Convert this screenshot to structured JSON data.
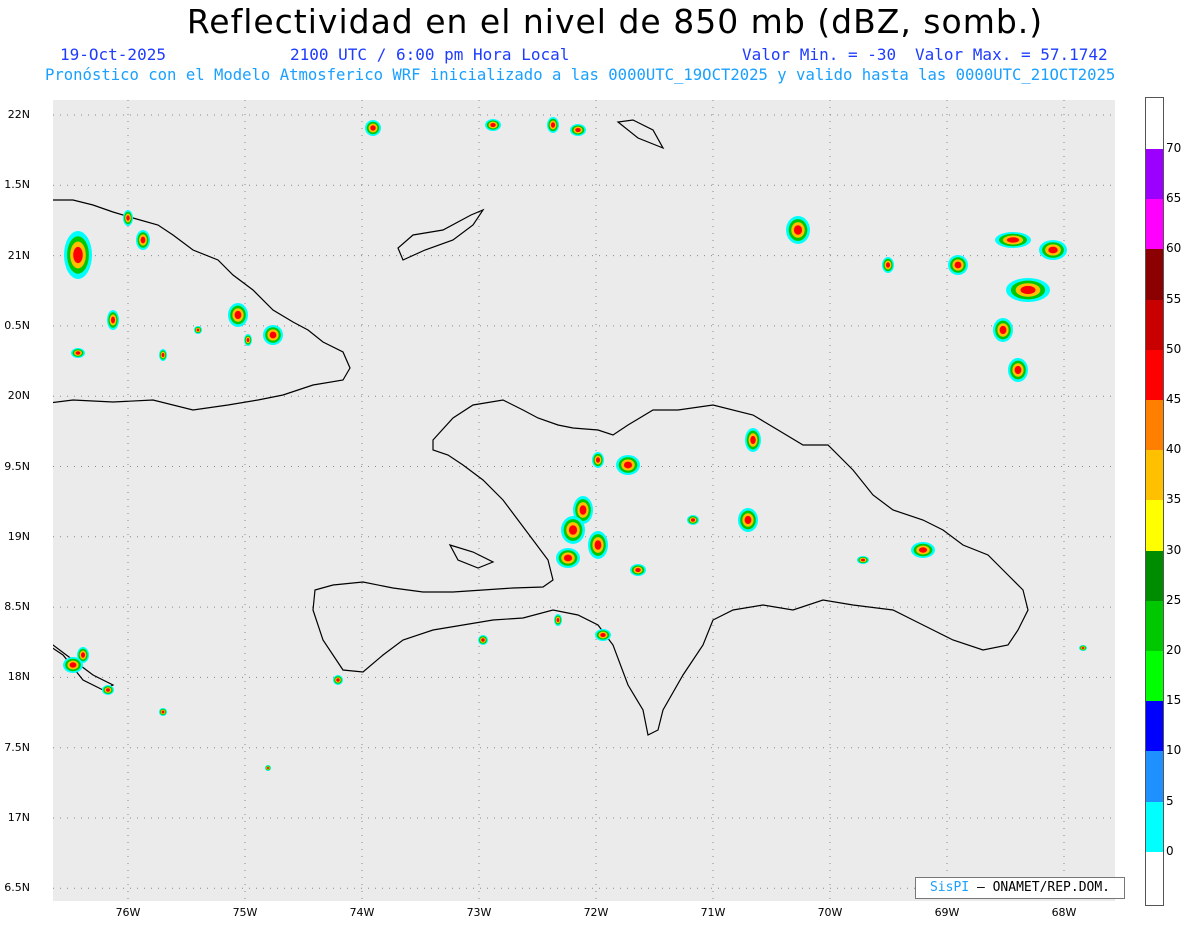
{
  "header": {
    "title": "Reflectividad en el nivel de 850 mb (dBZ, somb.)",
    "date": "19-Oct-2025",
    "time": "2100 UTC / 6:00 pm Hora Local",
    "min_value": "Valor Min. = -30",
    "max_value": "Valor Max. = 57.1742",
    "forecast_note": "Pronóstico con el Modelo Atmosferico WRF inicializado a las 0000UTC_19OCT2025 y valido hasta las  0000UTC_21OCT2025"
  },
  "map": {
    "lat_labels": [
      "22N",
      "1.5N",
      "21N",
      "0.5N",
      "20N",
      "9.5N",
      "19N",
      "8.5N",
      "18N",
      "7.5N",
      "17N",
      "6.5N"
    ],
    "lon_labels": [
      "76W",
      "75W",
      "74W",
      "73W",
      "72W",
      "71W",
      "70W",
      "69W",
      "68W"
    ]
  },
  "colorbar": {
    "labels": [
      "70",
      "65",
      "60",
      "55",
      "50",
      "45",
      "40",
      "35",
      "30",
      "25",
      "20",
      "15",
      "10",
      "5",
      "0"
    ],
    "colors": [
      "#9b00ff",
      "#ff00ff",
      "#8b0000",
      "#c80000",
      "#ff0000",
      "#ff7f00",
      "#ffc000",
      "#ffff00",
      "#008c00",
      "#00c800",
      "#00ff00",
      "#0000ff",
      "#1e90ff",
      "#00ffff"
    ]
  },
  "credit": {
    "brand": "SisPI",
    "text": "– ONAMET/REP.DOM."
  }
}
